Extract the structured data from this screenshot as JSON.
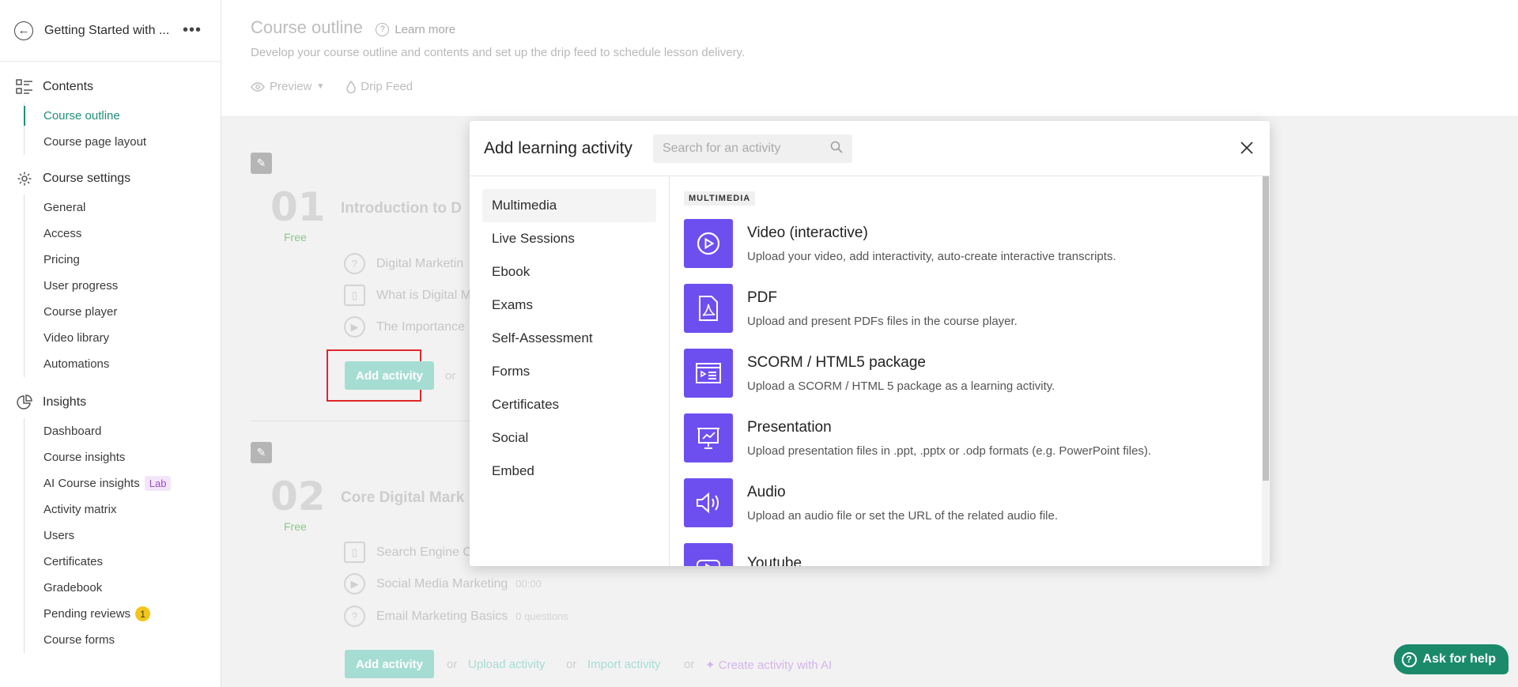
{
  "sidebar": {
    "course_title": "Getting Started with ...",
    "more": "•••",
    "sections": [
      {
        "label": "Contents",
        "items": [
          "Course outline",
          "Course page layout"
        ]
      },
      {
        "label": "Course settings",
        "items": [
          "General",
          "Access",
          "Pricing",
          "User progress",
          "Course player",
          "Video library",
          "Automations"
        ]
      },
      {
        "label": "Insights",
        "items": [
          "Dashboard",
          "Course insights",
          "AI Course insights",
          "Activity matrix",
          "Users",
          "Certificates",
          "Gradebook",
          "Pending reviews",
          "Course forms"
        ]
      }
    ],
    "lab_badge": "Lab",
    "pending_count": "1"
  },
  "header": {
    "title": "Course outline",
    "learn_more": "Learn more",
    "subtitle": "Develop your course outline and contents and set up the drip feed to schedule lesson delivery.",
    "preview": "Preview",
    "drip_feed": "Drip Feed"
  },
  "modules": [
    {
      "number": "01",
      "price": "Free",
      "title": "Introduction to D",
      "lessons": [
        {
          "title": "Digital Marketin",
          "icon": "question-icon"
        },
        {
          "title": "What is Digital M",
          "icon": "book-icon"
        },
        {
          "title": "The Importance",
          "icon": "play-icon"
        }
      ]
    },
    {
      "number": "02",
      "price": "Free",
      "title": "Core Digital Mark",
      "lessons": [
        {
          "title": "Search Engine C",
          "icon": "book-icon",
          "meta": ""
        },
        {
          "title": "Social Media Marketing",
          "icon": "play-icon",
          "meta": "00:00"
        },
        {
          "title": "Email Marketing Basics",
          "icon": "question-icon",
          "meta": "0 questions"
        }
      ]
    }
  ],
  "actions": {
    "add_activity": "Add activity",
    "or": "or",
    "upload_activity": "Upload activity",
    "import_activity": "Import activity",
    "create_ai": "Create activity with AI"
  },
  "modal": {
    "title": "Add learning activity",
    "search_placeholder": "Search for an activity",
    "categories": [
      "Multimedia",
      "Live Sessions",
      "Ebook",
      "Exams",
      "Self-Assessment",
      "Forms",
      "Certificates",
      "Social",
      "Embed"
    ],
    "selected_category": "Multimedia",
    "section_tag": "MULTIMEDIA",
    "activities": [
      {
        "title": "Video (interactive)",
        "desc": "Upload your video, add interactivity, auto-create interactive transcripts.",
        "icon": "video-play-icon"
      },
      {
        "title": "PDF",
        "desc": "Upload and present PDFs files in the course player.",
        "icon": "pdf-icon"
      },
      {
        "title": "SCORM / HTML5 package",
        "desc": "Upload a SCORM / HTML 5 package as a learning activity.",
        "icon": "scorm-icon"
      },
      {
        "title": "Presentation",
        "desc": "Upload presentation files in .ppt, .pptx or .odp formats (e.g. PowerPoint files).",
        "icon": "presentation-icon"
      },
      {
        "title": "Audio",
        "desc": "Upload an audio file or set the URL of the related audio file.",
        "icon": "speaker-icon"
      },
      {
        "title": "Youtube",
        "desc": "",
        "icon": "youtube-icon"
      }
    ]
  },
  "help": {
    "label": "Ask for help"
  },
  "colors": {
    "accent": "#1f8f7a",
    "activity_icon_bg": "#6d4ff0",
    "highlight": "#e0262a"
  }
}
